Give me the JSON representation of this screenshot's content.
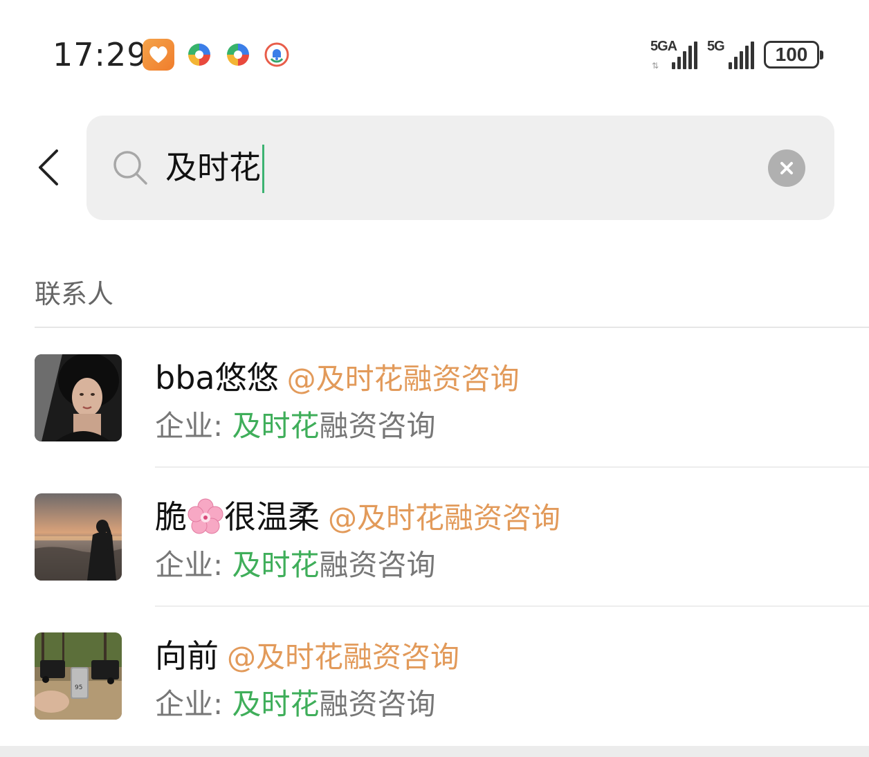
{
  "status_bar": {
    "time": "17:29",
    "notif_icons": [
      "heart-app-icon",
      "colorful-app-icon",
      "colorful-app-icon",
      "bell-app-icon"
    ],
    "signal1_label": "5GA",
    "signal2_label": "5G",
    "battery": "100"
  },
  "search": {
    "query": "及时花",
    "icon": "search-icon",
    "clear_icon": "close-icon"
  },
  "section": {
    "title": "联系人"
  },
  "contacts": [
    {
      "name": "bba悠悠",
      "corp_tag": "@及时花融资咨询",
      "sub_prefix": "企业: ",
      "sub_highlight": "及时花",
      "sub_rest": "融资咨询"
    },
    {
      "name_part1": "脆",
      "name_emoji": "cherry-blossom-icon",
      "name_part2": "很温柔",
      "corp_tag": "@及时花融资咨询",
      "sub_prefix": "企业: ",
      "sub_highlight": "及时花",
      "sub_rest": "融资咨询"
    },
    {
      "name": "向前",
      "corp_tag": "@及时花融资咨询",
      "sub_prefix": "企业: ",
      "sub_highlight": "及时花",
      "sub_rest": "融资咨询"
    }
  ],
  "colors": {
    "highlight": "#3fae5a",
    "corp_tag": "#e29a5a",
    "caret": "#3cb371"
  }
}
